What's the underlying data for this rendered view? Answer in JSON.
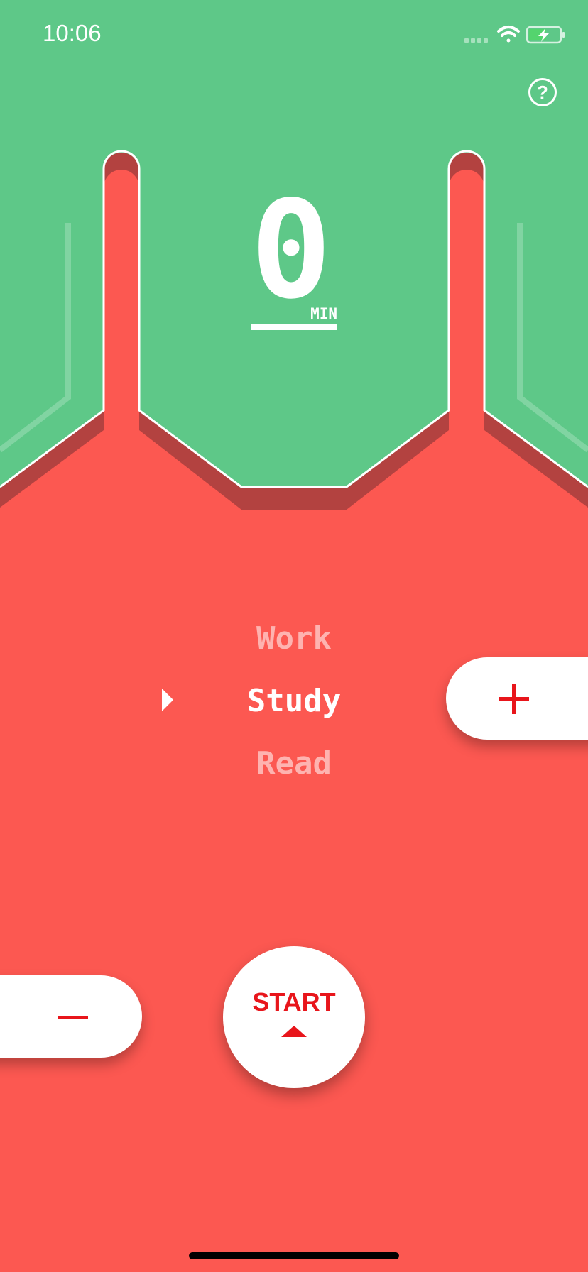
{
  "status_bar": {
    "time": "10:06",
    "icons": [
      "cellular-signal-icon",
      "wifi-icon",
      "battery-charging-icon"
    ]
  },
  "header": {
    "help_icon": "question-mark-icon",
    "help_glyph": "?"
  },
  "timer": {
    "value": "0",
    "unit": "MIN"
  },
  "activities": {
    "items": [
      {
        "label": "Work",
        "selected": false
      },
      {
        "label": "Study",
        "selected": true
      },
      {
        "label": "Read",
        "selected": false
      }
    ],
    "selection_indicator_icon": "triangle-right-icon"
  },
  "controls": {
    "increase_icon": "plus-icon",
    "decrease_icon": "minus-icon",
    "start_label": "START",
    "start_icon": "triangle-up-icon"
  },
  "colors": {
    "background_green": "#5ec888",
    "liquid_red": "#fc5851",
    "liquid_shadow": "#b34240",
    "accent_red": "#e8151b",
    "white": "#ffffff"
  }
}
